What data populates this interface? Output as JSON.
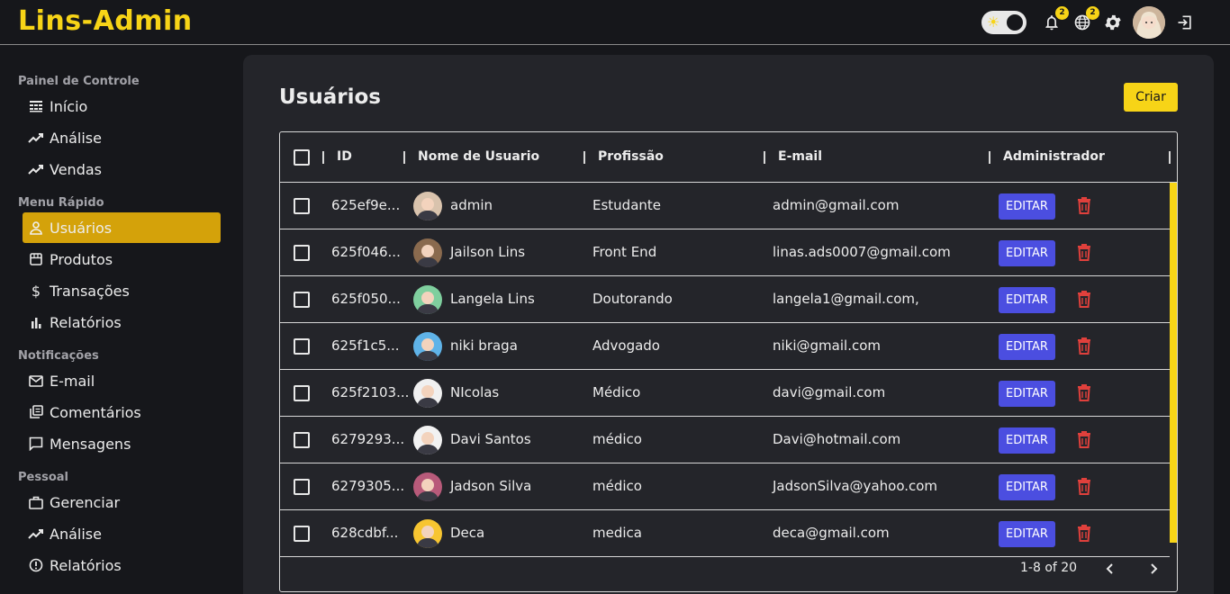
{
  "app": {
    "title": "Lins-Admin"
  },
  "header": {
    "notifications_badge": "2",
    "language_badge": "2",
    "icons": [
      "theme-toggle-icon",
      "bell-icon",
      "globe-icon",
      "gear-icon",
      "user-avatar",
      "logout-icon"
    ]
  },
  "sidebar": {
    "sections": [
      {
        "title": "Painel de Controle",
        "items": [
          {
            "label": "Início",
            "icon": "dashboard-icon"
          },
          {
            "label": "Análise",
            "icon": "trending-icon"
          },
          {
            "label": "Vendas",
            "icon": "trending-icon"
          }
        ]
      },
      {
        "title": "Menu Rápido",
        "items": [
          {
            "label": "Usuários",
            "icon": "person-icon",
            "active": true
          },
          {
            "label": "Produtos",
            "icon": "store-icon"
          },
          {
            "label": "Transações",
            "icon": "dollar-icon"
          },
          {
            "label": "Relatórios",
            "icon": "bar-chart-icon"
          }
        ]
      },
      {
        "title": "Notificações",
        "items": [
          {
            "label": "E-mail",
            "icon": "mail-icon"
          },
          {
            "label": "Comentários",
            "icon": "library-icon"
          },
          {
            "label": "Mensagens",
            "icon": "chat-icon"
          }
        ]
      },
      {
        "title": "Pessoal",
        "items": [
          {
            "label": "Gerenciar",
            "icon": "briefcase-icon"
          },
          {
            "label": "Análise",
            "icon": "trending-icon"
          },
          {
            "label": "Relatórios",
            "icon": "report-icon"
          }
        ]
      }
    ]
  },
  "main": {
    "title": "Usuários",
    "create_label": "Criar",
    "columns": [
      "ID",
      "Nome de Usuario",
      "Profissão",
      "E-mail",
      "Administrador"
    ],
    "edit_label": "EDITAR",
    "rows": [
      {
        "id": "625ef9e...",
        "name": "admin",
        "profession": "Estudante",
        "email": "admin@gmail.com",
        "avatar_color": "#d9c3ad"
      },
      {
        "id": "625f046...",
        "name": "Jailson Lins",
        "profession": "Front End",
        "email": "linas.ads0007@gmail.com",
        "avatar_color": "#8a6a4e"
      },
      {
        "id": "625f050...",
        "name": "Langela Lins",
        "profession": "Doutorando",
        "email": "langela1@gmail.com,",
        "avatar_color": "#7fcf9e"
      },
      {
        "id": "625f1c5...",
        "name": "niki braga",
        "profession": "Advogado",
        "email": "niki@gmail.com",
        "avatar_color": "#5fb3e8"
      },
      {
        "id": "625f2103...",
        "name": "NIcolas",
        "profession": "Médico",
        "email": "davi@gmail.com",
        "avatar_color": "#f0f0f0"
      },
      {
        "id": "6279293...",
        "name": "Davi Santos",
        "profession": "médico",
        "email": "Davi@hotmail.com",
        "avatar_color": "#f2f2f2"
      },
      {
        "id": "6279305...",
        "name": "Jadson Silva",
        "profession": "médico",
        "email": "JadsonSilva@yahoo.com",
        "avatar_color": "#b85a7a"
      },
      {
        "id": "628cdbf...",
        "name": "Deca",
        "profession": "medica",
        "email": "deca@gmail.com",
        "avatar_color": "#f7c531"
      }
    ],
    "pagination": "1-8 of 20"
  },
  "colors": {
    "accent": "#f7d417",
    "active_nav": "#d4a20a",
    "edit_button": "#4b4ee0",
    "delete_icon": "#e0403c"
  }
}
